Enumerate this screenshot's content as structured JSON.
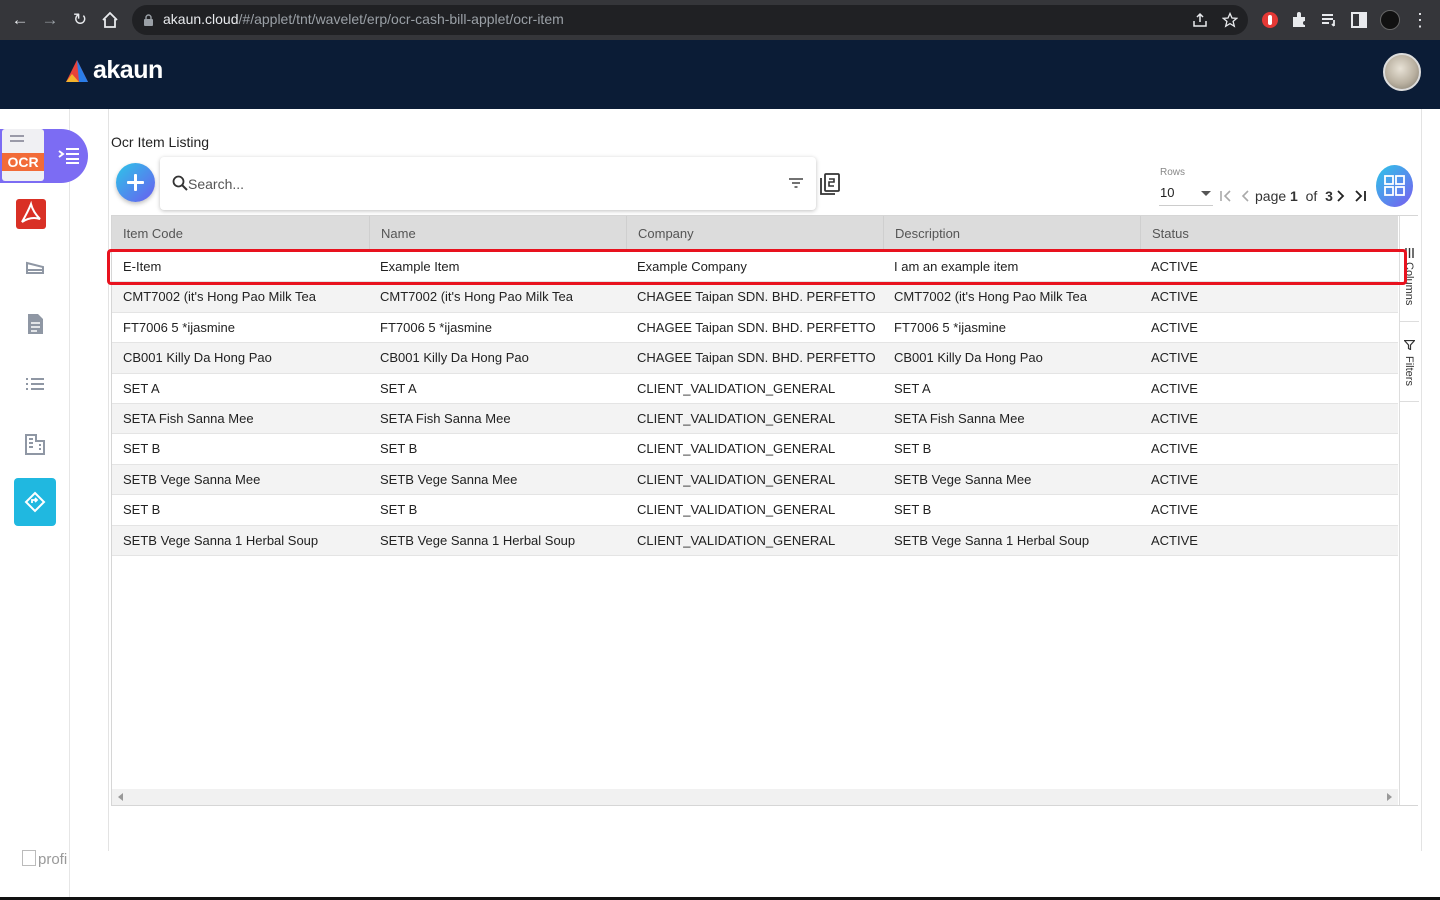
{
  "browser": {
    "url_host": "akaun.cloud",
    "url_path": "/#/applet/tnt/wavelet/erp/ocr-cash-bill-applet/ocr-item"
  },
  "app": {
    "logo_text": "akaun",
    "applet_badge": "OCR"
  },
  "sidebar": {
    "profile_label": "profi"
  },
  "page": {
    "title": "Ocr Item Listing"
  },
  "search": {
    "placeholder": "Search..."
  },
  "pagination": {
    "rows_label": "Rows",
    "rows_value": "10",
    "page_word": "page",
    "current_page": "1",
    "of_word": "of",
    "total_pages": "3"
  },
  "grid": {
    "columns": [
      "Item Code",
      "Name",
      "Company",
      "Description",
      "Status"
    ],
    "rows": [
      [
        "E-Item",
        "Example Item",
        "Example Company",
        "I am an example item",
        "ACTIVE"
      ],
      [
        "CMT7002 (it's Hong Pao Milk Tea",
        "CMT7002 (it's Hong Pao Milk Tea",
        "CHAGEE Taipan SDN. BHD. PERFETTO",
        "CMT7002 (it's Hong Pao Milk Tea",
        "ACTIVE"
      ],
      [
        "FT7006 5 *ijasmine",
        "FT7006 5 *ijasmine",
        "CHAGEE Taipan SDN. BHD. PERFETTO",
        "FT7006 5 *ijasmine",
        "ACTIVE"
      ],
      [
        "CB001 Killy Da Hong Pao",
        "CB001 Killy Da Hong Pao",
        "CHAGEE Taipan SDN. BHD. PERFETTO",
        "CB001 Killy Da Hong Pao",
        "ACTIVE"
      ],
      [
        "SET A",
        "SET A",
        "CLIENT_VALIDATION_GENERAL",
        "SET A",
        "ACTIVE"
      ],
      [
        "SETA Fish Sanna Mee",
        "SETA Fish Sanna Mee",
        "CLIENT_VALIDATION_GENERAL",
        "SETA Fish Sanna Mee",
        "ACTIVE"
      ],
      [
        "SET B",
        "SET B",
        "CLIENT_VALIDATION_GENERAL",
        "SET B",
        "ACTIVE"
      ],
      [
        "SETB Vege Sanna Mee",
        "SETB Vege Sanna Mee",
        "CLIENT_VALIDATION_GENERAL",
        "SETB Vege Sanna Mee",
        "ACTIVE"
      ],
      [
        "SET B",
        "SET B",
        "CLIENT_VALIDATION_GENERAL",
        "SET B",
        "ACTIVE"
      ],
      [
        "SETB Vege Sanna 1 Herbal Soup",
        "SETB Vege Sanna 1 Herbal Soup",
        "CLIENT_VALIDATION_GENERAL",
        "SETB Vege Sanna 1 Herbal Soup",
        "ACTIVE"
      ]
    ],
    "side_tabs": [
      "Columns",
      "Filters"
    ]
  },
  "colors": {
    "header_bg": "#0b1c36",
    "accent": "#20b8e0",
    "highlight": "#e8121e"
  }
}
